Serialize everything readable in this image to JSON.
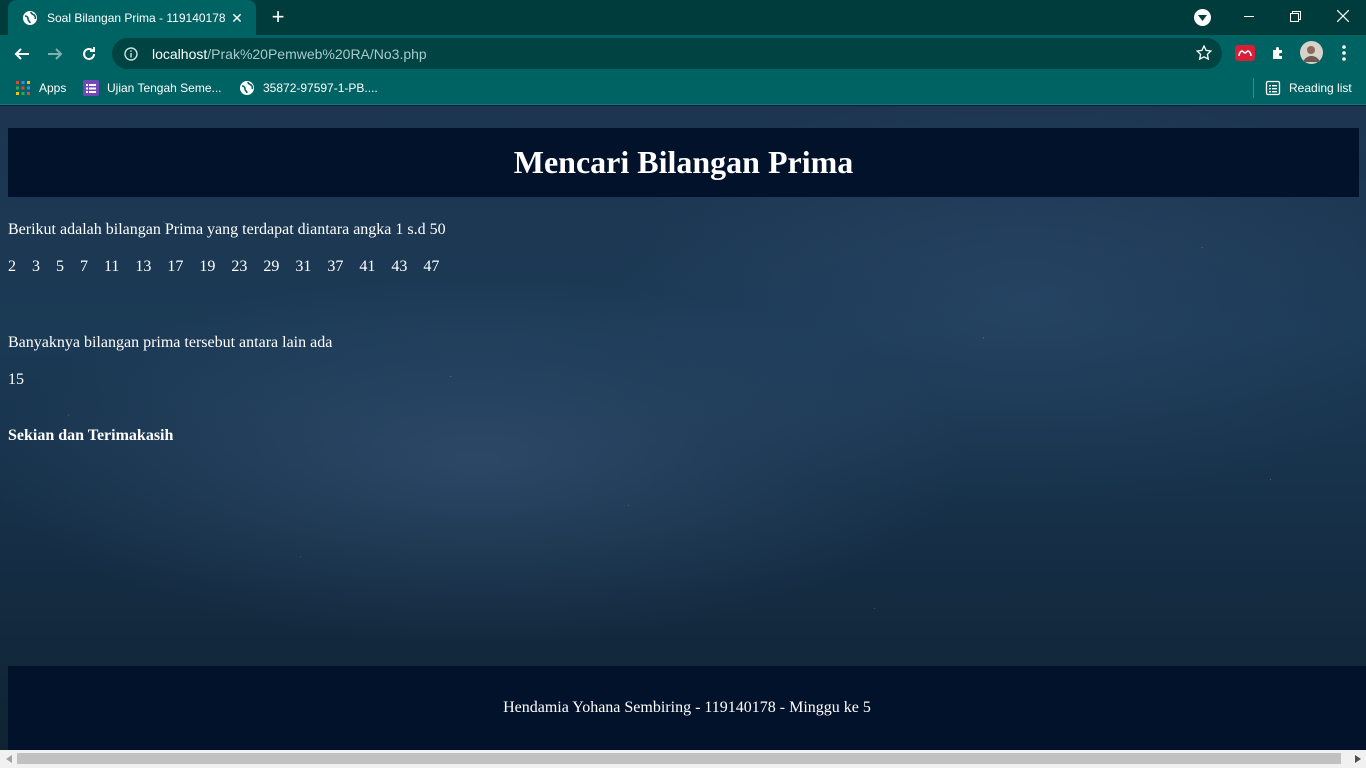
{
  "browser": {
    "tab_title": "Soal Bilangan Prima - 119140178",
    "url_host": "localhost",
    "url_path": "/Prak%20Pemweb%20RA/No3.php",
    "bookmarks": [
      {
        "label": "Apps",
        "icon": "apps-grid-icon"
      },
      {
        "label": "Ujian Tengah Seme...",
        "icon": "list-icon"
      },
      {
        "label": "35872-97597-1-PB....",
        "icon": "globe-icon"
      }
    ],
    "reading_list_label": "Reading list",
    "colors": {
      "frame": "#003c3c",
      "toolbar": "#006363",
      "omnibox": "#004343"
    }
  },
  "page": {
    "heading": "Mencari Bilangan Prima",
    "intro": "Berikut adalah bilangan Prima yang terdapat diantara angka 1 s.d 50",
    "primes": [
      "2",
      "3",
      "5",
      "7",
      "11",
      "13",
      "17",
      "19",
      "23",
      "29",
      "31",
      "37",
      "41",
      "43",
      "47"
    ],
    "count_label": "Banyaknya bilangan prima tersebut antara lain ada",
    "count_value": "15",
    "closing": "Sekian dan Terimakasih",
    "footer": "Hendamia Yohana Sembiring - 119140178 - Minggu ke 5",
    "colors": {
      "banner": "#01122a",
      "text": "#ffffff"
    }
  }
}
